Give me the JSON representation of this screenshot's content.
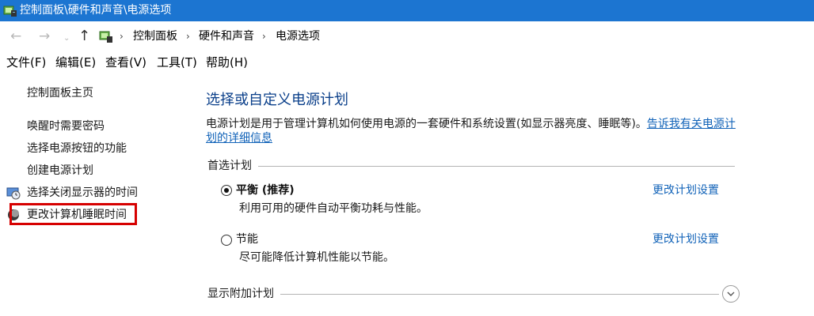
{
  "window": {
    "title": "控制面板\\硬件和声音\\电源选项"
  },
  "address": {
    "back_glyph": "←",
    "forward_glyph": "→",
    "history_glyph": "⌄",
    "up_glyph": "↑",
    "breadcrumbs": [
      "控制面板",
      "硬件和声音",
      "电源选项"
    ],
    "separator": "›"
  },
  "menu": [
    "文件(F)",
    "编辑(E)",
    "查看(V)",
    "工具(T)",
    "帮助(H)"
  ],
  "sidebar": {
    "home": "控制面板主页",
    "items": [
      "唤醒时需要密码",
      "选择电源按钮的功能",
      "创建电源计划",
      "选择关闭显示器的时间",
      "更改计算机睡眠时间"
    ]
  },
  "main": {
    "heading": "选择或自定义电源计划",
    "description": "电源计划是用于管理计算机如何使用电源的一套硬件和系统设置(如显示器亮度、睡眠等)。",
    "description_link": "告诉我有关电源计划的详细信息",
    "preferred_label": "首选计划",
    "plans": [
      {
        "name": "平衡 (推荐)",
        "desc": "利用可用的硬件自动平衡功耗与性能。",
        "link": "更改计划设置",
        "selected": true
      },
      {
        "name": "节能",
        "desc": "尽可能降低计算机性能以节能。",
        "link": "更改计划设置",
        "selected": false
      }
    ],
    "additional_label": "显示附加计划"
  },
  "colors": {
    "titlebar": "#1c75d1",
    "link": "#1062b8",
    "heading": "#0a3f8a",
    "highlight": "#d60000"
  }
}
